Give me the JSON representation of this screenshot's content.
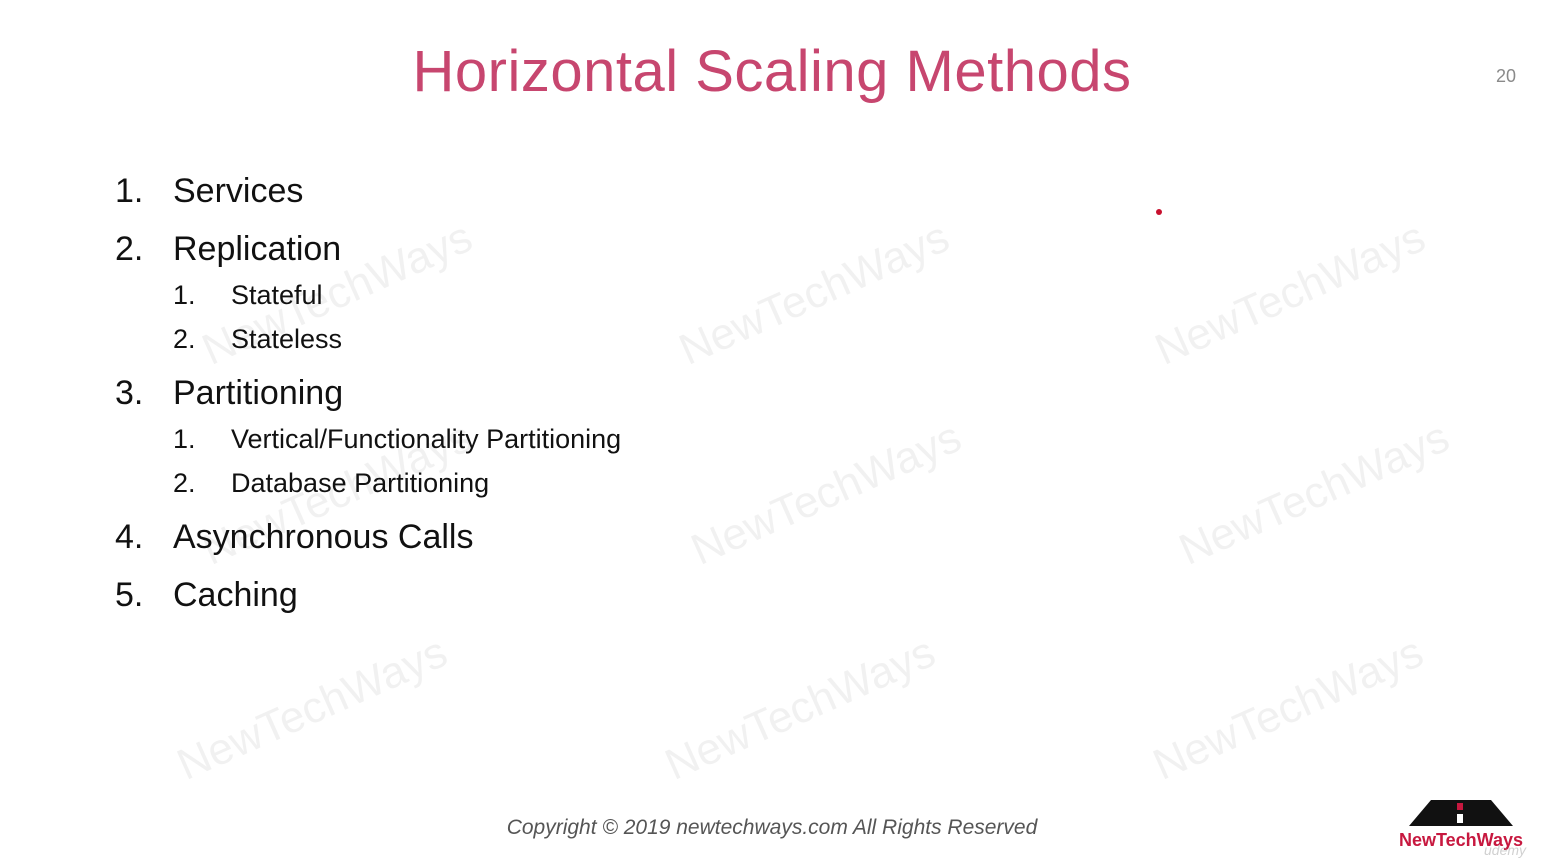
{
  "slide": {
    "title": "Horizontal Scaling Methods",
    "page_number": "20",
    "watermark_text": "NewTechWays",
    "items": [
      {
        "number": "1.",
        "label": "Services"
      },
      {
        "number": "2.",
        "label": "Replication"
      },
      {
        "number": "1.",
        "label": "Stateful"
      },
      {
        "number": "2.",
        "label": "Stateless"
      },
      {
        "number": "3.",
        "label": "Partitioning"
      },
      {
        "number": "1.",
        "label": "Vertical/Functionality Partitioning"
      },
      {
        "number": "2.",
        "label": "Database Partitioning"
      },
      {
        "number": "4.",
        "label": "Asynchronous Calls"
      },
      {
        "number": "5.",
        "label": "Caching"
      }
    ],
    "footer": "Copyright © 2019 newtechways.com All Rights Reserved",
    "logo_text": "NewTechWays",
    "udemy_mark": "udemy"
  },
  "colors": {
    "title": "#c7466f",
    "logo": "#c7183f",
    "pointer": "#c8102e"
  },
  "icons": {
    "logo_graphic": "road-triangle-icon",
    "pointer": "laser-pointer-dot"
  }
}
